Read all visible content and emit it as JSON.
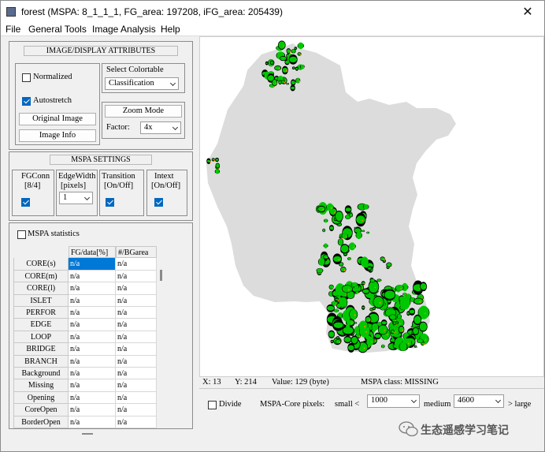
{
  "window": {
    "title": "forest (MSPA: 8_1_1_1, FG_area: 197208, iFG_area: 205439)",
    "close_glyph": "✕"
  },
  "menu": [
    "File",
    "General Tools",
    "Image Analysis",
    "Help"
  ],
  "image_display": {
    "title": "IMAGE/DISPLAY ATTRIBUTES",
    "normalized_label": "Normalized",
    "normalized_checked": false,
    "autostretch_label": "Autostretch",
    "autostretch_checked": true,
    "original_image_label": "Original Image",
    "image_info_label": "Image Info",
    "colortable_label": "Select Colortable",
    "colortable_value": "Classification",
    "zoom_mode_label": "Zoom Mode",
    "factor_label": "Factor:",
    "factor_value": "4x"
  },
  "mspa_settings": {
    "title": "MSPA SETTINGS",
    "fgconn_label": "FGConn",
    "fgconn_sub": "[8/4]",
    "fgconn_checked": true,
    "edgewidth_label": "EdgeWidth",
    "edgewidth_sub": "[pixels]",
    "edgewidth_value": "1",
    "transition_label": "Transition",
    "transition_sub": "[On/Off]",
    "transition_checked": true,
    "intext_label": "Intext",
    "intext_sub": "[On/Off]",
    "intext_checked": true
  },
  "stats": {
    "checkbox_label": "MSPA statistics",
    "checked": false,
    "columns": [
      "FG/data[%]",
      "#/BGarea"
    ],
    "rows": [
      {
        "name": "CORE(s)",
        "fg": "n/a",
        "bg": "n/a"
      },
      {
        "name": "CORE(m)",
        "fg": "n/a",
        "bg": "n/a"
      },
      {
        "name": "CORE(l)",
        "fg": "n/a",
        "bg": "n/a"
      },
      {
        "name": "ISLET",
        "fg": "n/a",
        "bg": "n/a"
      },
      {
        "name": "PERFOR",
        "fg": "n/a",
        "bg": "n/a"
      },
      {
        "name": "EDGE",
        "fg": "n/a",
        "bg": "n/a"
      },
      {
        "name": "LOOP",
        "fg": "n/a",
        "bg": "n/a"
      },
      {
        "name": "BRIDGE",
        "fg": "n/a",
        "bg": "n/a"
      },
      {
        "name": "BRANCH",
        "fg": "n/a",
        "bg": "n/a"
      },
      {
        "name": "Background",
        "fg": "n/a",
        "bg": "n/a"
      },
      {
        "name": "Missing",
        "fg": "n/a",
        "bg": "n/a"
      },
      {
        "name": "Opening",
        "fg": "n/a",
        "bg": "n/a"
      },
      {
        "name": "CoreOpen",
        "fg": "n/a",
        "bg": "n/a"
      },
      {
        "name": "BorderOpen",
        "fg": "n/a",
        "bg": "n/a"
      }
    ]
  },
  "status": {
    "x": "X: 13",
    "y": "Y: 214",
    "value": "Value: 129 (byte)",
    "mspa_class": "MSPA class: MISSING"
  },
  "bottom": {
    "divide_label": "Divide",
    "divide_checked": false,
    "core_pixels_label": "MSPA-Core pixels:",
    "small_label": "small <",
    "small_value": "1000",
    "medium_label": "medium",
    "medium_value": "4600",
    "large_label": "> large"
  },
  "watermark": {
    "text": "生态遥感学习笔记"
  },
  "colors": {
    "land": "#dcdcdc",
    "core": "#00c800",
    "edge": "#000000",
    "bridge": "#ff8c00",
    "selection": "#0078d7",
    "checkbox": "#0067c0"
  }
}
